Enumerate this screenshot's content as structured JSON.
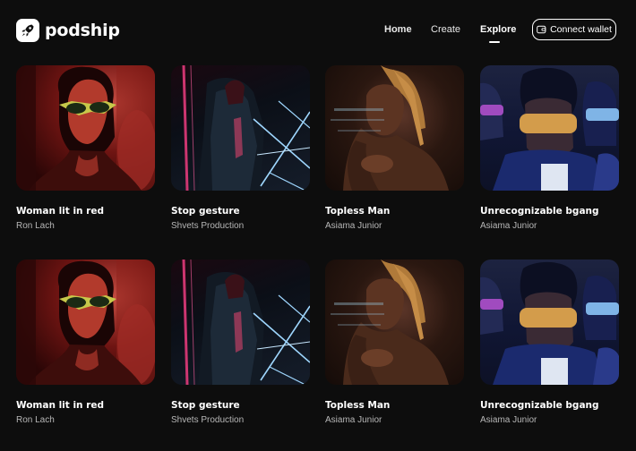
{
  "app": {
    "name": "podship"
  },
  "nav": {
    "items": [
      "Home",
      "Create",
      "Explore"
    ],
    "active": "Explore",
    "connect_label": "Connect wallet"
  },
  "gallery": {
    "rows": [
      [
        {
          "title": "Woman lit in red",
          "author": "Ron Lach",
          "art": "woman-red"
        },
        {
          "title": "Stop gesture",
          "author": "Shvets Production",
          "art": "stop-gesture"
        },
        {
          "title": "Topless Man",
          "author": "Asiama Junior",
          "art": "topless-man"
        },
        {
          "title": "Unrecognizable bgang",
          "author": "Asiama Junior",
          "art": "bgang"
        }
      ],
      [
        {
          "title": "Woman lit in red",
          "author": "Ron Lach",
          "art": "woman-red"
        },
        {
          "title": "Stop gesture",
          "author": "Shvets Production",
          "art": "stop-gesture"
        },
        {
          "title": "Topless Man",
          "author": "Asiama Junior",
          "art": "topless-man"
        },
        {
          "title": "Unrecognizable bgang",
          "author": "Asiama Junior",
          "art": "bgang"
        }
      ]
    ]
  },
  "colors": {
    "background": "#0d0d0d",
    "text": "#ffffff",
    "muted_text": "#b7b7b7"
  }
}
